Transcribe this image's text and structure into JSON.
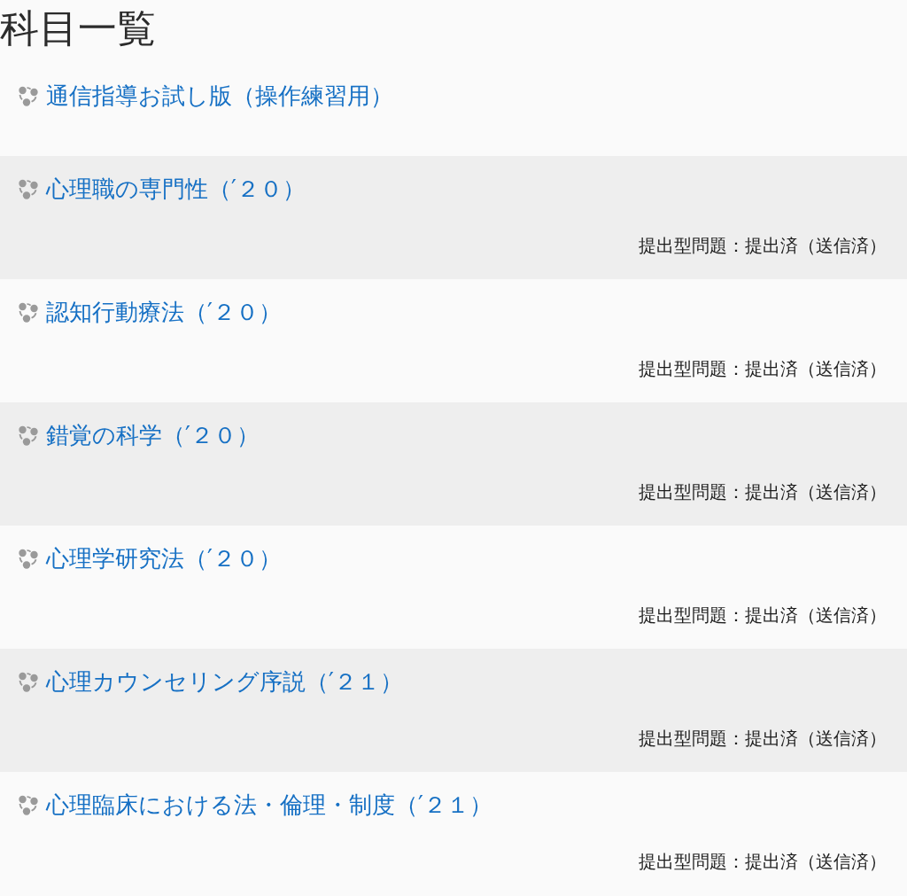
{
  "page": {
    "title": "科目一覧"
  },
  "courses": [
    {
      "name": "通信指導お試し版（操作練習用）"
    },
    {
      "name": "心理職の専門性（′２０）",
      "status": "提出型問題：提出済（送信済）"
    },
    {
      "name": "認知行動療法（′２０）",
      "status": "提出型問題：提出済（送信済）"
    },
    {
      "name": "錯覚の科学（′２０）",
      "status": "提出型問題：提出済（送信済）"
    },
    {
      "name": "心理学研究法（′２０）",
      "status": "提出型問題：提出済（送信済）"
    },
    {
      "name": "心理カウンセリング序説（′２１）",
      "status": "提出型問題：提出済（送信済）"
    },
    {
      "name": "心理臨床における法・倫理・制度（′２１）",
      "status": "提出型問題：提出済（送信済）"
    }
  ]
}
